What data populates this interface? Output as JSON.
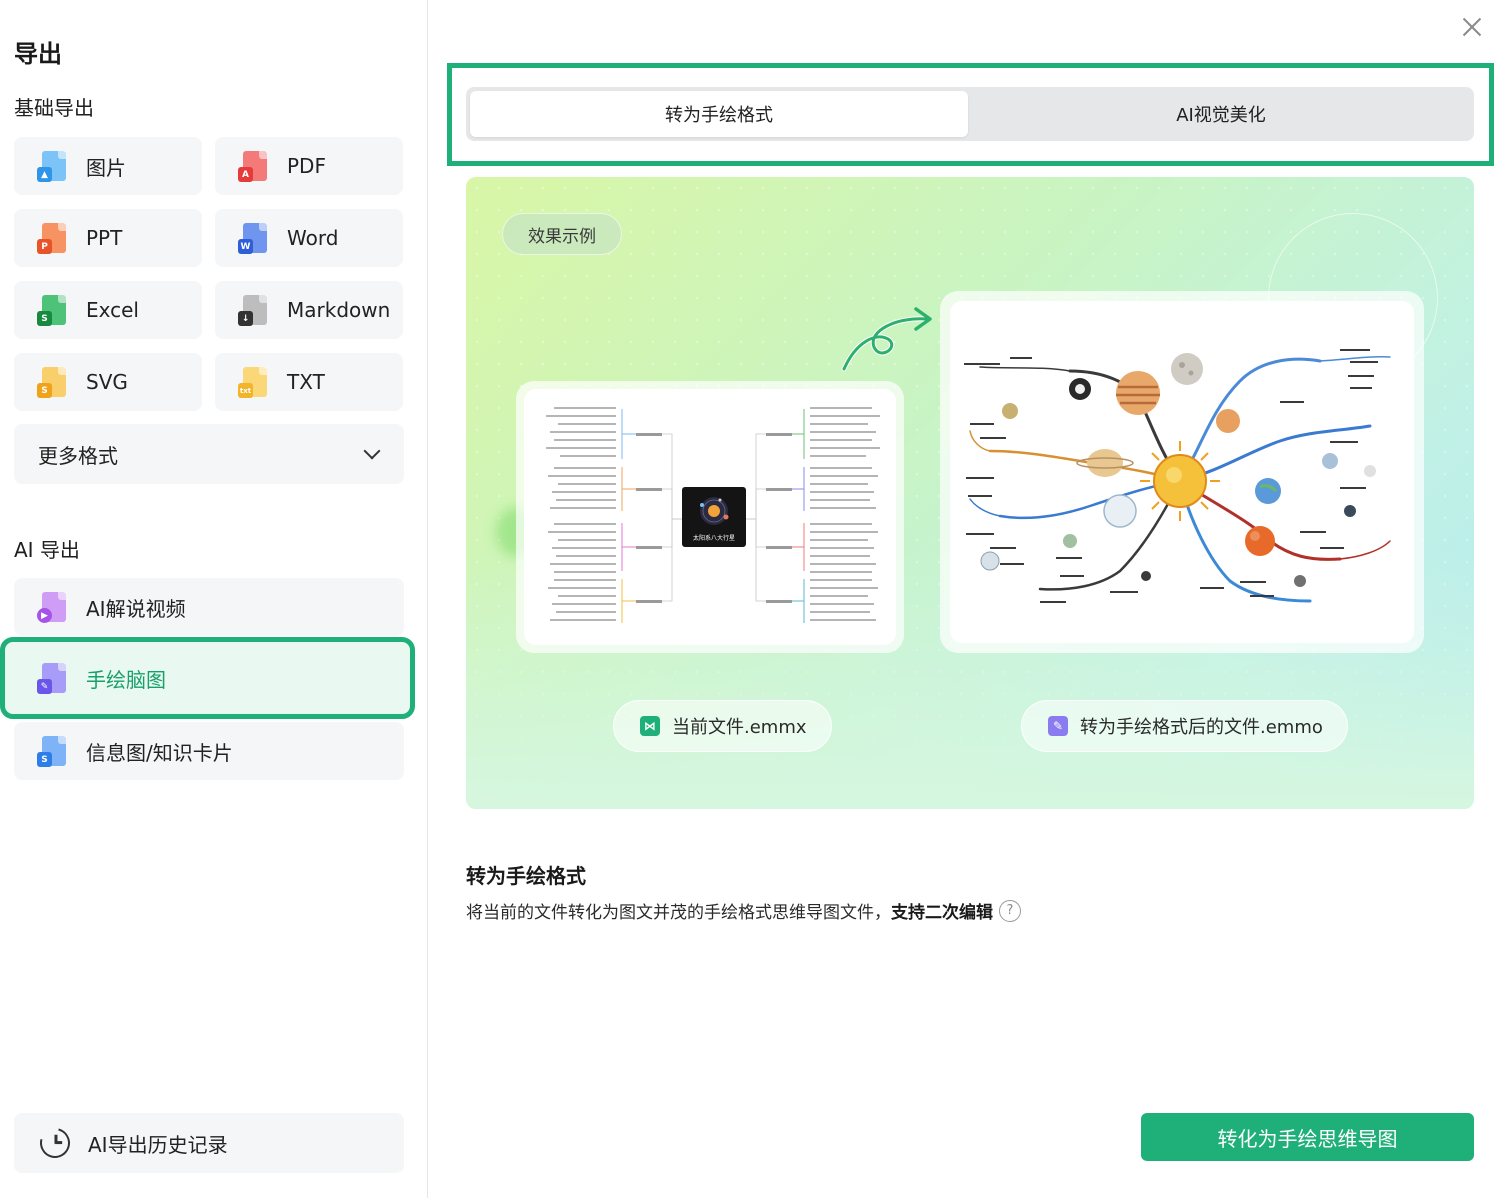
{
  "sidebar": {
    "title": "导出",
    "basic_section": "基础导出",
    "basic_items": [
      {
        "label": "图片",
        "icon": "image-file-icon",
        "color": "#3aa0f0"
      },
      {
        "label": "PDF",
        "icon": "pdf-file-icon",
        "color": "#f04d4d"
      },
      {
        "label": "PPT",
        "icon": "ppt-file-icon",
        "color": "#f26b3a"
      },
      {
        "label": "Word",
        "icon": "word-file-icon",
        "color": "#3b6fe0"
      },
      {
        "label": "Excel",
        "icon": "excel-file-icon",
        "color": "#1fa34e"
      },
      {
        "label": "Markdown",
        "icon": "markdown-file-icon",
        "color": "#444444"
      },
      {
        "label": "SVG",
        "icon": "svg-file-icon",
        "color": "#f5b12e"
      },
      {
        "label": "TXT",
        "icon": "txt-file-icon",
        "color": "#f7c23c"
      }
    ],
    "more_formats": "更多格式",
    "ai_section": "AI 导出",
    "ai_items": [
      {
        "label": "AI解说视频",
        "icon": "video-file-icon",
        "color": "#b36ef0"
      },
      {
        "label": "手绘脑图",
        "icon": "handdrawn-file-icon",
        "color": "#7b6cf0"
      },
      {
        "label": "信息图/知识卡片",
        "icon": "infographic-file-icon",
        "color": "#3b8ef0"
      }
    ],
    "history": "AI导出历史记录"
  },
  "tabs": [
    "转为手绘格式",
    "AI视觉美化"
  ],
  "demo": {
    "example_label": "效果示例",
    "current_file": "当前文件.emmx",
    "converted_file": "转为手绘格式后的文件.emmo",
    "left_center_label": "太阳系八大行星"
  },
  "description": {
    "title": "转为手绘格式",
    "text": "将当前的文件转化为图文并茂的手绘格式思维导图文件，",
    "bold": "支持二次编辑",
    "help": "?"
  },
  "cta": "转化为手绘思维导图",
  "colors": {
    "accent": "#1fb07a",
    "active_bg": "#e9f8f1"
  }
}
